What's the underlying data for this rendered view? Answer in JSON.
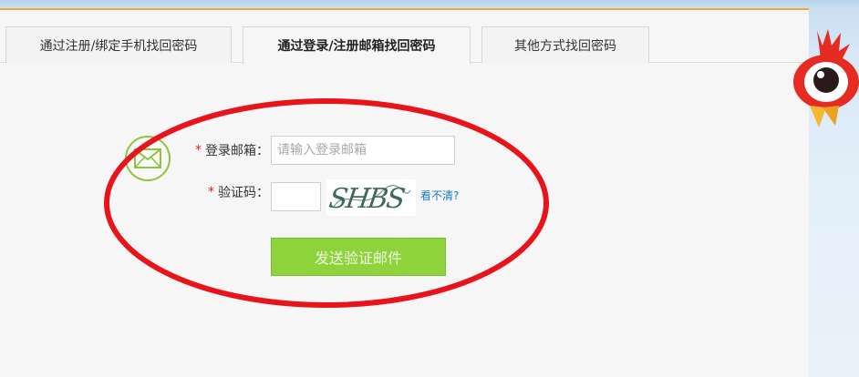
{
  "tabs": [
    {
      "label": "通过注册/绑定手机找回密码",
      "active": false
    },
    {
      "label": "通过登录/注册邮箱找回密码",
      "active": true
    },
    {
      "label": "其他方式找回密码",
      "active": false
    }
  ],
  "form": {
    "email": {
      "required_mark": "*",
      "label": "登录邮箱：",
      "placeholder": "请输入登录邮箱",
      "value": ""
    },
    "code": {
      "required_mark": "*",
      "label": "验证码：",
      "value": "",
      "captcha_text": "SHBS",
      "refresh_link": "看不清?"
    },
    "submit_label": "发送验证邮件"
  },
  "icons": {
    "mail": "envelope-icon",
    "mascot": "weibo-mascot-icon"
  },
  "colors": {
    "accent_green": "#8ed23c",
    "tab_top_border": "#f0a830",
    "annotation_red": "#e8141c",
    "link_blue": "#1a7cc0"
  }
}
